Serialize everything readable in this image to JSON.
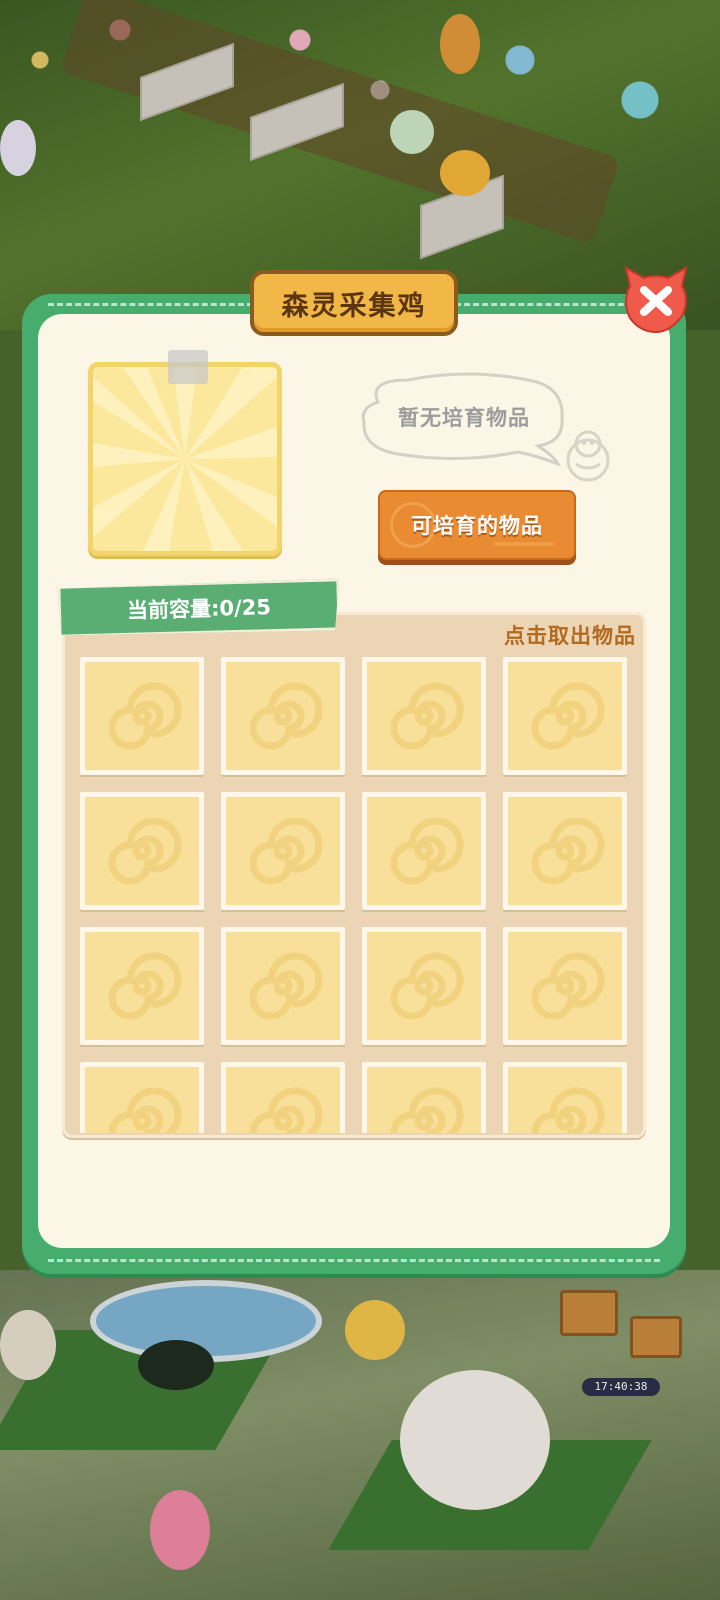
{
  "modal": {
    "title": "森灵采集鸡",
    "close_icon": "close-icon",
    "empty_message": "暂无培育物品",
    "breedable_button_label": "可培育的物品",
    "capacity_label": "当前容量:0/25",
    "hint": "点击取出物品"
  },
  "storage": {
    "capacity_used": 0,
    "capacity_total": 25,
    "visible_slots": 16,
    "slot_icon": "swirl-placeholder-icon"
  },
  "status_bar": {
    "timer": "17:40:38"
  },
  "colors": {
    "frame_green": "#46ad6f",
    "panel_cream": "#fbf6e6",
    "title_gold": "#f2b847",
    "button_orange": "#e98b33",
    "slot_yellow": "#f8e09a",
    "close_red": "#f05a4b"
  }
}
